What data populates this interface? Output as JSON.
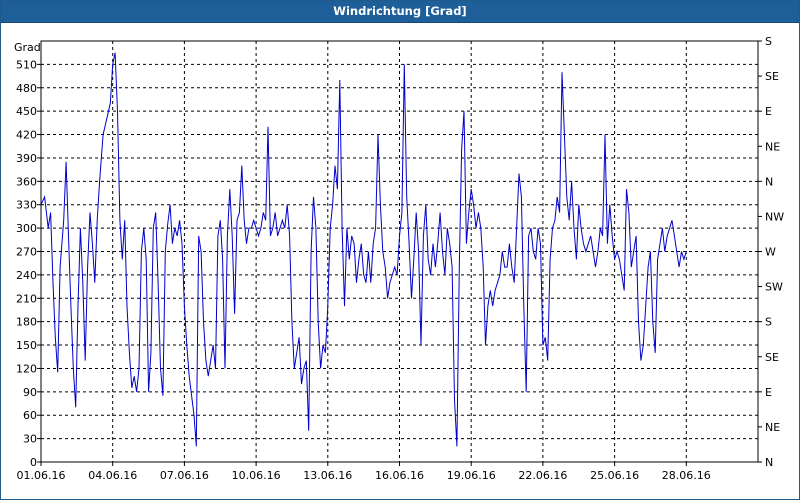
{
  "window": {
    "title": "Windrichtung [Grad]"
  },
  "chart_data": {
    "type": "line",
    "title": "Windrichtung [Grad]",
    "ylabel": "Grad",
    "xlabel": "",
    "ylim": [
      0,
      540
    ],
    "xlim": [
      0,
      30
    ],
    "grid": true,
    "x_tick_labels": [
      {
        "x": 0,
        "label": "01.06.16"
      },
      {
        "x": 3,
        "label": "04.06.16"
      },
      {
        "x": 6,
        "label": "07.06.16"
      },
      {
        "x": 9,
        "label": "10.06.16"
      },
      {
        "x": 12,
        "label": "13.06.16"
      },
      {
        "x": 15,
        "label": "16.06.16"
      },
      {
        "x": 18,
        "label": "19.06.16"
      },
      {
        "x": 21,
        "label": "22.06.16"
      },
      {
        "x": 24,
        "label": "25.06.16"
      },
      {
        "x": 27,
        "label": "28.06.16"
      }
    ],
    "y_ticks": [
      0,
      30,
      60,
      90,
      120,
      150,
      180,
      210,
      240,
      270,
      300,
      330,
      360,
      390,
      420,
      450,
      480,
      510
    ],
    "right_axis": [
      {
        "y": 0,
        "label": "N"
      },
      {
        "y": 45,
        "label": "NE"
      },
      {
        "y": 90,
        "label": "E"
      },
      {
        "y": 135,
        "label": "SE"
      },
      {
        "y": 180,
        "label": "S"
      },
      {
        "y": 225,
        "label": "SW"
      },
      {
        "y": 270,
        "label": "W"
      },
      {
        "y": 315,
        "label": "NW"
      },
      {
        "y": 360,
        "label": "N"
      },
      {
        "y": 405,
        "label": "NE"
      },
      {
        "y": 450,
        "label": "E"
      },
      {
        "y": 495,
        "label": "SE"
      },
      {
        "y": 540,
        "label": "S"
      }
    ],
    "series": [
      {
        "color": "#0000cc",
        "points": [
          [
            0.0,
            330
          ],
          [
            0.15,
            340
          ],
          [
            0.3,
            300
          ],
          [
            0.4,
            320
          ],
          [
            0.5,
            230
          ],
          [
            0.6,
            160
          ],
          [
            0.7,
            115
          ],
          [
            0.8,
            250
          ],
          [
            0.95,
            310
          ],
          [
            1.05,
            385
          ],
          [
            1.15,
            290
          ],
          [
            1.25,
            200
          ],
          [
            1.35,
            120
          ],
          [
            1.45,
            70
          ],
          [
            1.55,
            200
          ],
          [
            1.65,
            300
          ],
          [
            1.75,
            230
          ],
          [
            1.85,
            130
          ],
          [
            1.95,
            250
          ],
          [
            2.05,
            320
          ],
          [
            2.15,
            280
          ],
          [
            2.25,
            230
          ],
          [
            2.35,
            310
          ],
          [
            2.45,
            360
          ],
          [
            2.6,
            420
          ],
          [
            2.75,
            440
          ],
          [
            2.9,
            460
          ],
          [
            3.0,
            510
          ],
          [
            3.1,
            525
          ],
          [
            3.2,
            450
          ],
          [
            3.3,
            310
          ],
          [
            3.4,
            260
          ],
          [
            3.5,
            310
          ],
          [
            3.6,
            200
          ],
          [
            3.7,
            140
          ],
          [
            3.8,
            95
          ],
          [
            3.9,
            110
          ],
          [
            4.0,
            90
          ],
          [
            4.1,
            120
          ],
          [
            4.2,
            270
          ],
          [
            4.3,
            300
          ],
          [
            4.4,
            260
          ],
          [
            4.5,
            90
          ],
          [
            4.6,
            140
          ],
          [
            4.7,
            300
          ],
          [
            4.8,
            320
          ],
          [
            4.9,
            230
          ],
          [
            5.0,
            120
          ],
          [
            5.1,
            85
          ],
          [
            5.2,
            270
          ],
          [
            5.3,
            305
          ],
          [
            5.4,
            330
          ],
          [
            5.5,
            280
          ],
          [
            5.6,
            300
          ],
          [
            5.7,
            290
          ],
          [
            5.8,
            310
          ],
          [
            5.9,
            280
          ],
          [
            6.0,
            200
          ],
          [
            6.1,
            150
          ],
          [
            6.2,
            110
          ],
          [
            6.3,
            85
          ],
          [
            6.4,
            60
          ],
          [
            6.5,
            20
          ],
          [
            6.6,
            290
          ],
          [
            6.7,
            270
          ],
          [
            6.8,
            180
          ],
          [
            6.9,
            130
          ],
          [
            7.0,
            110
          ],
          [
            7.1,
            130
          ],
          [
            7.2,
            150
          ],
          [
            7.3,
            120
          ],
          [
            7.4,
            290
          ],
          [
            7.5,
            310
          ],
          [
            7.6,
            260
          ],
          [
            7.7,
            120
          ],
          [
            7.8,
            290
          ],
          [
            7.9,
            350
          ],
          [
            8.0,
            290
          ],
          [
            8.1,
            190
          ],
          [
            8.2,
            310
          ],
          [
            8.3,
            320
          ],
          [
            8.4,
            380
          ],
          [
            8.5,
            310
          ],
          [
            8.6,
            280
          ],
          [
            8.7,
            300
          ],
          [
            8.8,
            300
          ],
          [
            8.9,
            310
          ],
          [
            9.0,
            300
          ],
          [
            9.1,
            290
          ],
          [
            9.2,
            300
          ],
          [
            9.3,
            320
          ],
          [
            9.4,
            310
          ],
          [
            9.5,
            430
          ],
          [
            9.6,
            290
          ],
          [
            9.7,
            300
          ],
          [
            9.8,
            320
          ],
          [
            9.9,
            290
          ],
          [
            10.0,
            300
          ],
          [
            10.1,
            310
          ],
          [
            10.2,
            300
          ],
          [
            10.3,
            330
          ],
          [
            10.4,
            290
          ],
          [
            10.5,
            180
          ],
          [
            10.6,
            120
          ],
          [
            10.7,
            140
          ],
          [
            10.8,
            160
          ],
          [
            10.9,
            100
          ],
          [
            11.0,
            120
          ],
          [
            11.1,
            130
          ],
          [
            11.2,
            40
          ],
          [
            11.3,
            270
          ],
          [
            11.4,
            340
          ],
          [
            11.5,
            300
          ],
          [
            11.6,
            180
          ],
          [
            11.7,
            120
          ],
          [
            11.8,
            150
          ],
          [
            11.9,
            140
          ],
          [
            12.0,
            200
          ],
          [
            12.1,
            300
          ],
          [
            12.2,
            330
          ],
          [
            12.3,
            380
          ],
          [
            12.4,
            350
          ],
          [
            12.5,
            490
          ],
          [
            12.6,
            300
          ],
          [
            12.7,
            200
          ],
          [
            12.8,
            300
          ],
          [
            12.9,
            260
          ],
          [
            13.0,
            290
          ],
          [
            13.1,
            280
          ],
          [
            13.2,
            230
          ],
          [
            13.3,
            260
          ],
          [
            13.4,
            280
          ],
          [
            13.5,
            240
          ],
          [
            13.6,
            230
          ],
          [
            13.7,
            270
          ],
          [
            13.8,
            230
          ],
          [
            13.9,
            280
          ],
          [
            14.0,
            300
          ],
          [
            14.1,
            420
          ],
          [
            14.2,
            330
          ],
          [
            14.3,
            270
          ],
          [
            14.4,
            250
          ],
          [
            14.5,
            210
          ],
          [
            14.6,
            230
          ],
          [
            14.7,
            240
          ],
          [
            14.8,
            250
          ],
          [
            14.9,
            240
          ],
          [
            15.0,
            290
          ],
          [
            15.1,
            320
          ],
          [
            15.2,
            510
          ],
          [
            15.3,
            340
          ],
          [
            15.4,
            280
          ],
          [
            15.5,
            210
          ],
          [
            15.6,
            260
          ],
          [
            15.7,
            320
          ],
          [
            15.8,
            270
          ],
          [
            15.9,
            150
          ],
          [
            16.0,
            290
          ],
          [
            16.1,
            330
          ],
          [
            16.2,
            260
          ],
          [
            16.3,
            240
          ],
          [
            16.4,
            280
          ],
          [
            16.5,
            250
          ],
          [
            16.6,
            280
          ],
          [
            16.7,
            320
          ],
          [
            16.8,
            270
          ],
          [
            16.9,
            240
          ],
          [
            17.0,
            300
          ],
          [
            17.1,
            280
          ],
          [
            17.2,
            250
          ],
          [
            17.3,
            80
          ],
          [
            17.4,
            20
          ],
          [
            17.5,
            250
          ],
          [
            17.6,
            400
          ],
          [
            17.7,
            450
          ],
          [
            17.8,
            280
          ],
          [
            17.9,
            320
          ],
          [
            18.0,
            350
          ],
          [
            18.1,
            330
          ],
          [
            18.2,
            300
          ],
          [
            18.3,
            320
          ],
          [
            18.4,
            300
          ],
          [
            18.5,
            250
          ],
          [
            18.6,
            150
          ],
          [
            18.7,
            200
          ],
          [
            18.8,
            220
          ],
          [
            18.9,
            200
          ],
          [
            19.0,
            220
          ],
          [
            19.1,
            230
          ],
          [
            19.2,
            240
          ],
          [
            19.3,
            270
          ],
          [
            19.4,
            250
          ],
          [
            19.5,
            250
          ],
          [
            19.6,
            280
          ],
          [
            19.7,
            250
          ],
          [
            19.8,
            230
          ],
          [
            19.9,
            300
          ],
          [
            20.0,
            370
          ],
          [
            20.1,
            340
          ],
          [
            20.2,
            200
          ],
          [
            20.3,
            90
          ],
          [
            20.4,
            290
          ],
          [
            20.5,
            300
          ],
          [
            20.6,
            270
          ],
          [
            20.7,
            260
          ],
          [
            20.8,
            300
          ],
          [
            20.9,
            280
          ],
          [
            21.0,
            150
          ],
          [
            21.1,
            160
          ],
          [
            21.2,
            130
          ],
          [
            21.3,
            260
          ],
          [
            21.4,
            300
          ],
          [
            21.5,
            310
          ],
          [
            21.6,
            340
          ],
          [
            21.7,
            320
          ],
          [
            21.8,
            500
          ],
          [
            21.9,
            420
          ],
          [
            22.0,
            340
          ],
          [
            22.1,
            310
          ],
          [
            22.2,
            360
          ],
          [
            22.3,
            300
          ],
          [
            22.4,
            260
          ],
          [
            22.5,
            330
          ],
          [
            22.6,
            300
          ],
          [
            22.7,
            280
          ],
          [
            22.8,
            270
          ],
          [
            22.9,
            280
          ],
          [
            23.0,
            290
          ],
          [
            23.1,
            270
          ],
          [
            23.2,
            250
          ],
          [
            23.3,
            270
          ],
          [
            23.4,
            300
          ],
          [
            23.5,
            290
          ],
          [
            23.6,
            420
          ],
          [
            23.7,
            280
          ],
          [
            23.8,
            330
          ],
          [
            23.9,
            290
          ],
          [
            24.0,
            260
          ],
          [
            24.1,
            270
          ],
          [
            24.2,
            260
          ],
          [
            24.3,
            240
          ],
          [
            24.4,
            220
          ],
          [
            24.5,
            350
          ],
          [
            24.6,
            320
          ],
          [
            24.7,
            250
          ],
          [
            24.8,
            270
          ],
          [
            24.9,
            290
          ],
          [
            25.0,
            180
          ],
          [
            25.1,
            130
          ],
          [
            25.2,
            150
          ],
          [
            25.3,
            200
          ],
          [
            25.4,
            250
          ],
          [
            25.5,
            270
          ],
          [
            25.6,
            180
          ],
          [
            25.7,
            140
          ],
          [
            25.8,
            260
          ],
          [
            25.9,
            280
          ],
          [
            26.0,
            300
          ],
          [
            26.1,
            270
          ],
          [
            26.2,
            290
          ],
          [
            26.3,
            300
          ],
          [
            26.4,
            310
          ],
          [
            26.5,
            290
          ],
          [
            26.6,
            270
          ],
          [
            26.7,
            250
          ],
          [
            26.8,
            270
          ],
          [
            26.9,
            260
          ],
          [
            27.0,
            270
          ]
        ]
      }
    ]
  }
}
